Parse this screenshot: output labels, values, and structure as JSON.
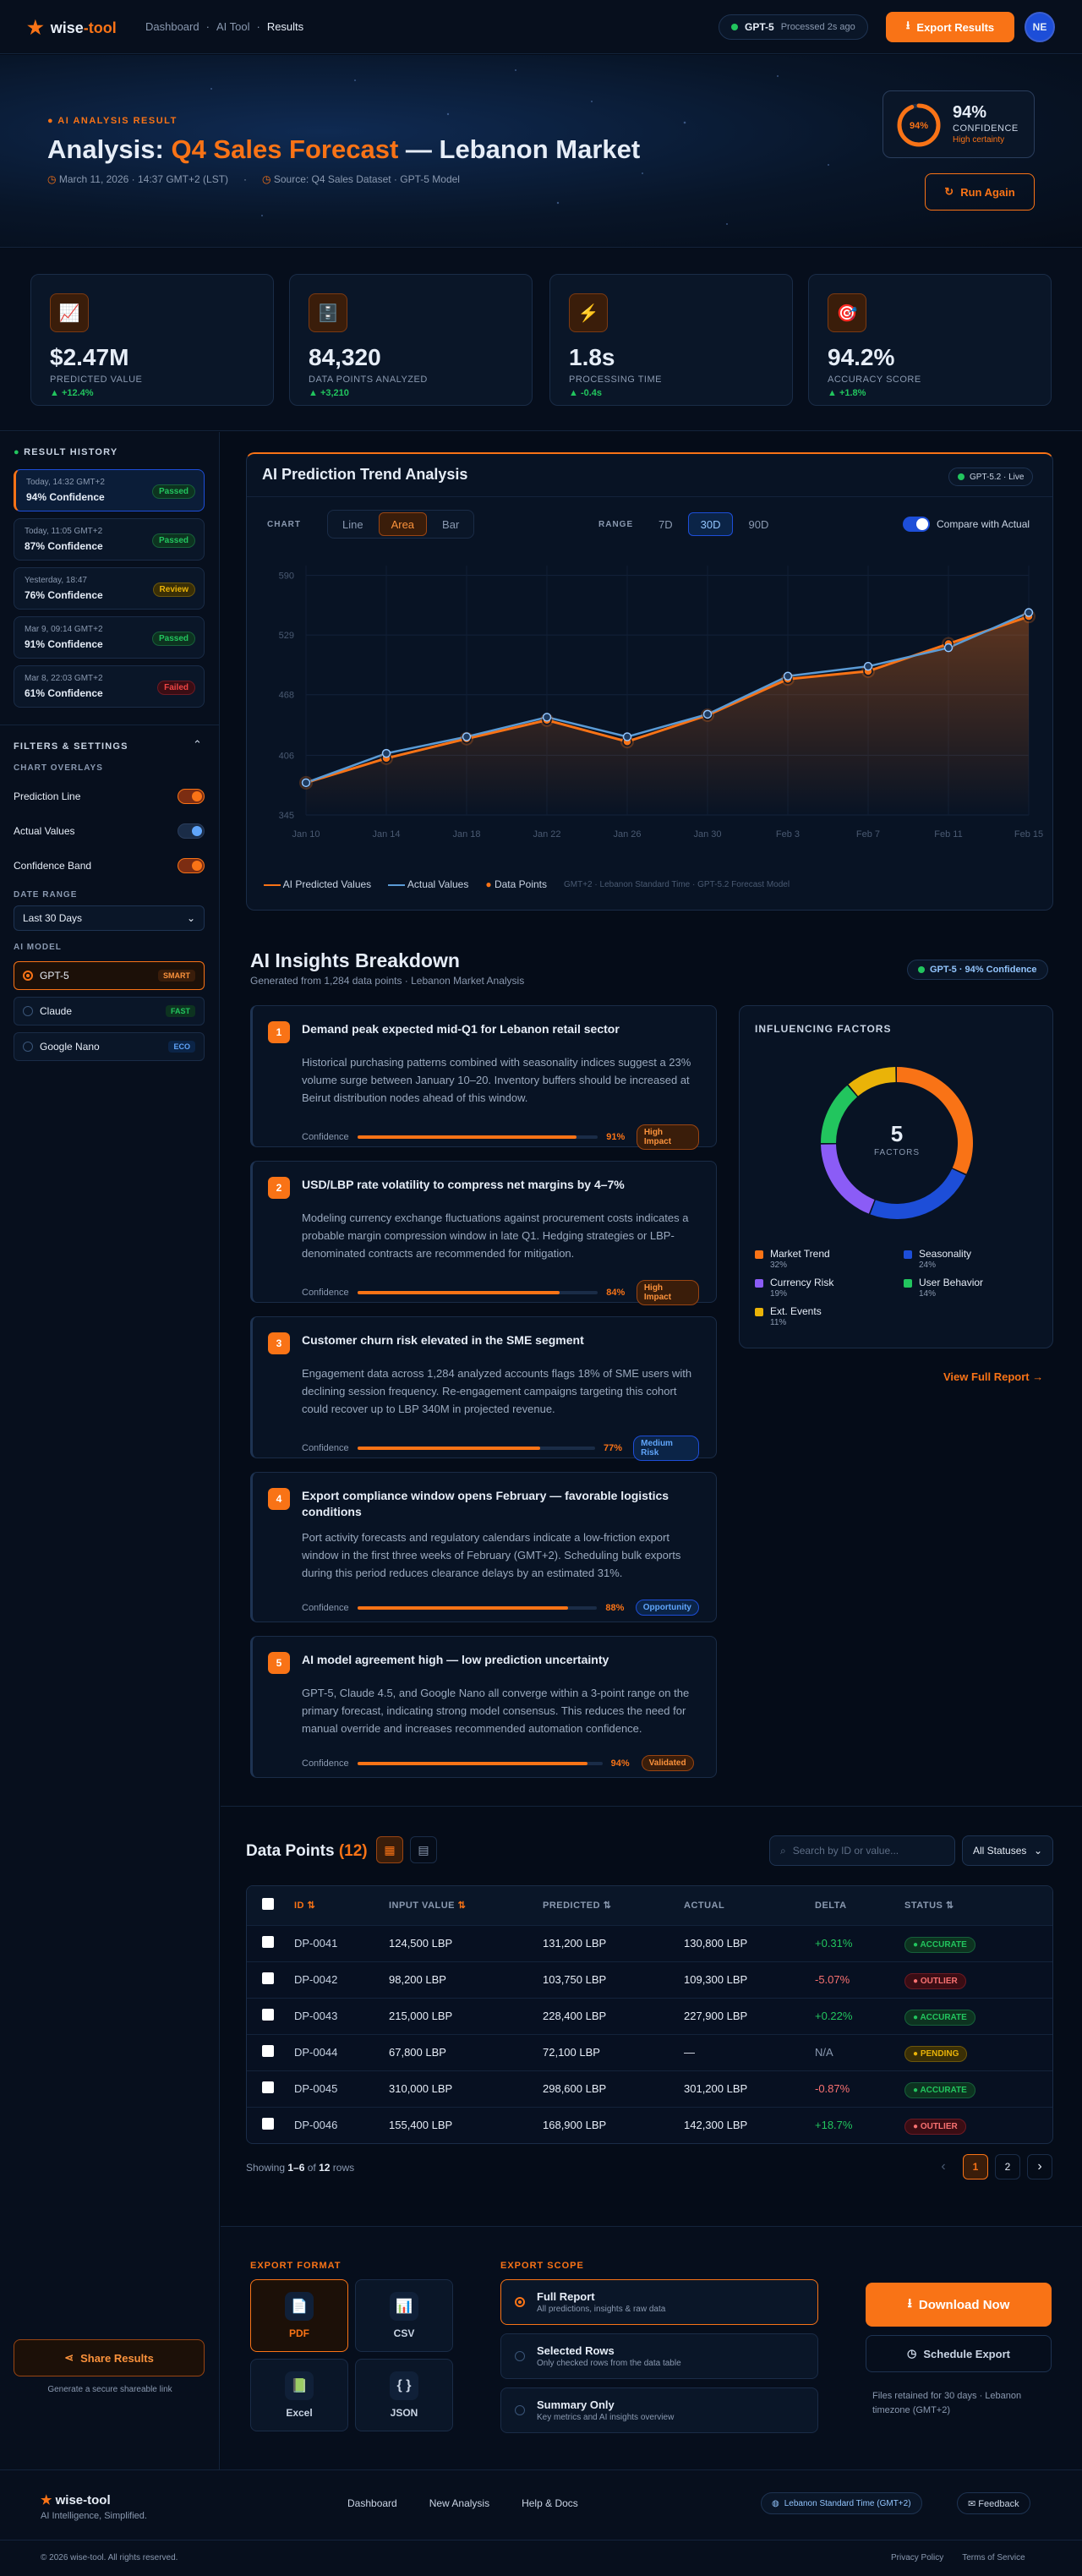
{
  "header": {
    "brand_a": "wise",
    "brand_b": "-tool",
    "crumbs": [
      "Dashboard",
      "AI Tool",
      "Results"
    ],
    "model": "GPT-5",
    "processed": "Processed 2s ago",
    "export_label": "Export Results",
    "avatar": "NE"
  },
  "hero": {
    "eyebrow": "AI ANALYSIS RESULT",
    "title_prefix": "Analysis: ",
    "title_highlight": "Q4 Sales Forecast",
    "title_suffix": " — Lebanon Market",
    "date": "March 11, 2026 · 14:37 GMT+2 (LST)",
    "source": "Source: Q4 Sales Dataset · GPT-5 Model",
    "confidence_value": "94%",
    "confidence_ring": "94%",
    "confidence_label": "CONFIDENCE",
    "confidence_sub": "High certainty",
    "run_again": "Run Again"
  },
  "stats": [
    {
      "icon": "📈",
      "value": "$2.47M",
      "label": "PREDICTED VALUE",
      "trend": "▲ +12.4%"
    },
    {
      "icon": "🗄️",
      "value": "84,320",
      "label": "DATA POINTS ANALYZED",
      "trend": "▲ +3,210"
    },
    {
      "icon": "⚡",
      "value": "1.8s",
      "label": "PROCESSING TIME",
      "trend": "▲ -0.4s"
    },
    {
      "icon": "🎯",
      "value": "94.2%",
      "label": "ACCURACY SCORE",
      "trend": "▲ +1.8%"
    }
  ],
  "sidebar": {
    "history_title": "RESULT HISTORY",
    "history": [
      {
        "time": "Today, 14:32 GMT+2",
        "conf": "94% Confidence",
        "status": "Passed"
      },
      {
        "time": "Today, 11:05 GMT+2",
        "conf": "87% Confidence",
        "status": "Passed"
      },
      {
        "time": "Yesterday, 18:47",
        "conf": "76% Confidence",
        "status": "Review"
      },
      {
        "time": "Mar 9, 09:14 GMT+2",
        "conf": "91% Confidence",
        "status": "Passed"
      },
      {
        "time": "Mar 8, 22:03 GMT+2",
        "conf": "61% Confidence",
        "status": "Failed"
      }
    ],
    "filters_title": "FILTERS & SETTINGS",
    "overlays_title": "CHART OVERLAYS",
    "overlays": [
      {
        "label": "Prediction Line",
        "on": true
      },
      {
        "label": "Actual Values",
        "on": false
      },
      {
        "label": "Confidence Band",
        "on": true
      }
    ],
    "date_range_title": "DATE RANGE",
    "date_range": "Last 30 Days",
    "model_title": "AI MODEL",
    "models": [
      {
        "name": "GPT-5",
        "tag": "SMART"
      },
      {
        "name": "Claude",
        "tag": "FAST"
      },
      {
        "name": "Google Nano",
        "tag": "ECO"
      }
    ],
    "share": "Share Results",
    "share_sub": "Generate a secure shareable link"
  },
  "chart": {
    "title": "AI Prediction Trend Analysis",
    "live": "GPT-5.2 · Live",
    "chart_label": "CHART",
    "types": [
      "Line",
      "Area",
      "Bar"
    ],
    "range_label": "RANGE",
    "ranges": [
      "7D",
      "30D",
      "90D"
    ],
    "compare": "Compare with Actual",
    "legend_pred": "AI Predicted Values",
    "legend_act": "Actual Values",
    "legend_pts": "Data Points",
    "footnote": "GMT+2 · Lebanon Standard Time · GPT-5.2 Forecast Model"
  },
  "chart_data": {
    "type": "area",
    "x": [
      "Jan 10",
      "Jan 14",
      "Jan 18",
      "Jan 22",
      "Jan 26",
      "Jan 30",
      "Feb 3",
      "Feb 7",
      "Feb 11",
      "Feb 15"
    ],
    "y_ticks": [
      345,
      406,
      468,
      529,
      590
    ],
    "ylim": [
      345,
      600
    ],
    "series": [
      {
        "name": "AI Predicted Values",
        "color": "#f97316",
        "values": [
          378,
          403,
          423,
          442,
          420,
          447,
          484,
          492,
          520,
          548
        ]
      },
      {
        "name": "Actual Values",
        "color": "#5b9bd5",
        "values": [
          378,
          408,
          425,
          445,
          425,
          448,
          487,
          497,
          516,
          552
        ]
      }
    ],
    "grid": true,
    "legend": "bottom"
  },
  "insights": {
    "title": "AI Insights Breakdown",
    "subtitle": "Generated from 1,284 data points · Lebanon Market Analysis",
    "badge": "GPT-5 · 94% Confidence",
    "conf_label": "Confidence",
    "items": [
      {
        "n": "1",
        "title": "Demand peak expected mid-Q1 for Lebanon retail sector",
        "body": "Historical purchasing patterns combined with seasonality indices suggest a 23% volume surge between January 10–20. Inventory buffers should be increased at Beirut distribution nodes ahead of this window.",
        "pct": "91%",
        "tag": "High Impact"
      },
      {
        "n": "2",
        "title": "USD/LBP rate volatility to compress net margins by 4–7%",
        "body": "Modeling currency exchange fluctuations against procurement costs indicates a probable margin compression window in late Q1. Hedging strategies or LBP-denominated contracts are recommended for mitigation.",
        "pct": "84%",
        "tag": "High Impact"
      },
      {
        "n": "3",
        "title": "Customer churn risk elevated in the SME segment",
        "body": "Engagement data across 1,284 analyzed accounts flags 18% of SME users with declining session frequency. Re-engagement campaigns targeting this cohort could recover up to LBP 340M in projected revenue.",
        "pct": "77%",
        "tag": "Medium Risk"
      },
      {
        "n": "4",
        "title": "Export compliance window opens February — favorable logistics conditions",
        "body": "Port activity forecasts and regulatory calendars indicate a low-friction export window in the first three weeks of February (GMT+2). Scheduling bulk exports during this period reduces clearance delays by an estimated 31%.",
        "pct": "88%",
        "tag": "Opportunity"
      },
      {
        "n": "5",
        "title": "AI model agreement high — low prediction uncertainty",
        "body": "GPT-5, Claude 4.5, and Google Nano all converge within a 3-point range on the primary forecast, indicating strong model consensus. This reduces the need for manual override and increases recommended automation confidence.",
        "pct": "94%",
        "tag": "Validated"
      }
    ],
    "factors_title": "INFLUENCING FACTORS",
    "factors_count": "5",
    "factors_label": "FACTORS",
    "factors": [
      {
        "name": "Market Trend",
        "pct": "32%",
        "value": 32,
        "color": "#f97316"
      },
      {
        "name": "Seasonality",
        "pct": "24%",
        "value": 24,
        "color": "#1d4ed8"
      },
      {
        "name": "Currency Risk",
        "pct": "19%",
        "value": 19,
        "color": "#8b5cf6"
      },
      {
        "name": "User Behavior",
        "pct": "14%",
        "value": 14,
        "color": "#22c55e"
      },
      {
        "name": "Ext. Events",
        "pct": "11%",
        "value": 11,
        "color": "#eab308"
      }
    ],
    "view_full": "View Full Report →"
  },
  "table": {
    "title": "Data Points ",
    "count": "(12)",
    "search_placeholder": "Search by ID or value...",
    "status_filter": "All Statuses",
    "headers": [
      "ID",
      "INPUT VALUE",
      "PREDICTED",
      "ACTUAL",
      "DELTA",
      "STATUS"
    ],
    "rows": [
      {
        "id": "DP-0041",
        "input": "124,500 LBP",
        "pred": "131,200 LBP",
        "act": "130,800 LBP",
        "delta": "+0.31%",
        "status": "ACCURATE"
      },
      {
        "id": "DP-0042",
        "input": "98,200 LBP",
        "pred": "103,750 LBP",
        "act": "109,300 LBP",
        "delta": "-5.07%",
        "status": "OUTLIER"
      },
      {
        "id": "DP-0043",
        "input": "215,000 LBP",
        "pred": "228,400 LBP",
        "act": "227,900 LBP",
        "delta": "+0.22%",
        "status": "ACCURATE"
      },
      {
        "id": "DP-0044",
        "input": "67,800 LBP",
        "pred": "72,100 LBP",
        "act": "—",
        "delta": "N/A",
        "status": "PENDING"
      },
      {
        "id": "DP-0045",
        "input": "310,000 LBP",
        "pred": "298,600 LBP",
        "act": "301,200 LBP",
        "delta": "-0.87%",
        "status": "ACCURATE"
      },
      {
        "id": "DP-0046",
        "input": "155,400 LBP",
        "pred": "168,900 LBP",
        "act": "142,300 LBP",
        "delta": "+18.7%",
        "status": "OUTLIER"
      }
    ],
    "showing_a": "Showing ",
    "showing_b": "1–6",
    "showing_c": " of ",
    "showing_d": "12",
    "showing_e": " rows",
    "pages": [
      "1",
      "2"
    ]
  },
  "export": {
    "format_title": "EXPORT FORMAT",
    "formats": [
      {
        "label": "PDF",
        "icon": "📄"
      },
      {
        "label": "CSV",
        "icon": "📊"
      },
      {
        "label": "Excel",
        "icon": "📗"
      },
      {
        "label": "JSON",
        "icon": "{ }"
      }
    ],
    "scope_title": "EXPORT SCOPE",
    "scopes": [
      {
        "t": "Full Report",
        "s": "All predictions, insights & raw data"
      },
      {
        "t": "Selected Rows",
        "s": "Only checked rows from the data table"
      },
      {
        "t": "Summary Only",
        "s": "Key metrics and AI insights overview"
      }
    ],
    "download": "Download Now",
    "schedule": "Schedule Export",
    "retention": "Files retained for 30 days · Lebanon timezone (GMT+2)"
  },
  "footer": {
    "brand": "wise-tool",
    "tagline": "AI Intelligence, Simplified.",
    "links": [
      "Dashboard",
      "New Analysis",
      "Help & Docs"
    ],
    "tz": "Lebanon Standard Time (GMT+2)",
    "feedback": "✉ Feedback",
    "copyright": "© 2026 wise-tool. All rights reserved.",
    "legal": [
      "Privacy Policy",
      "Terms of Service"
    ]
  }
}
